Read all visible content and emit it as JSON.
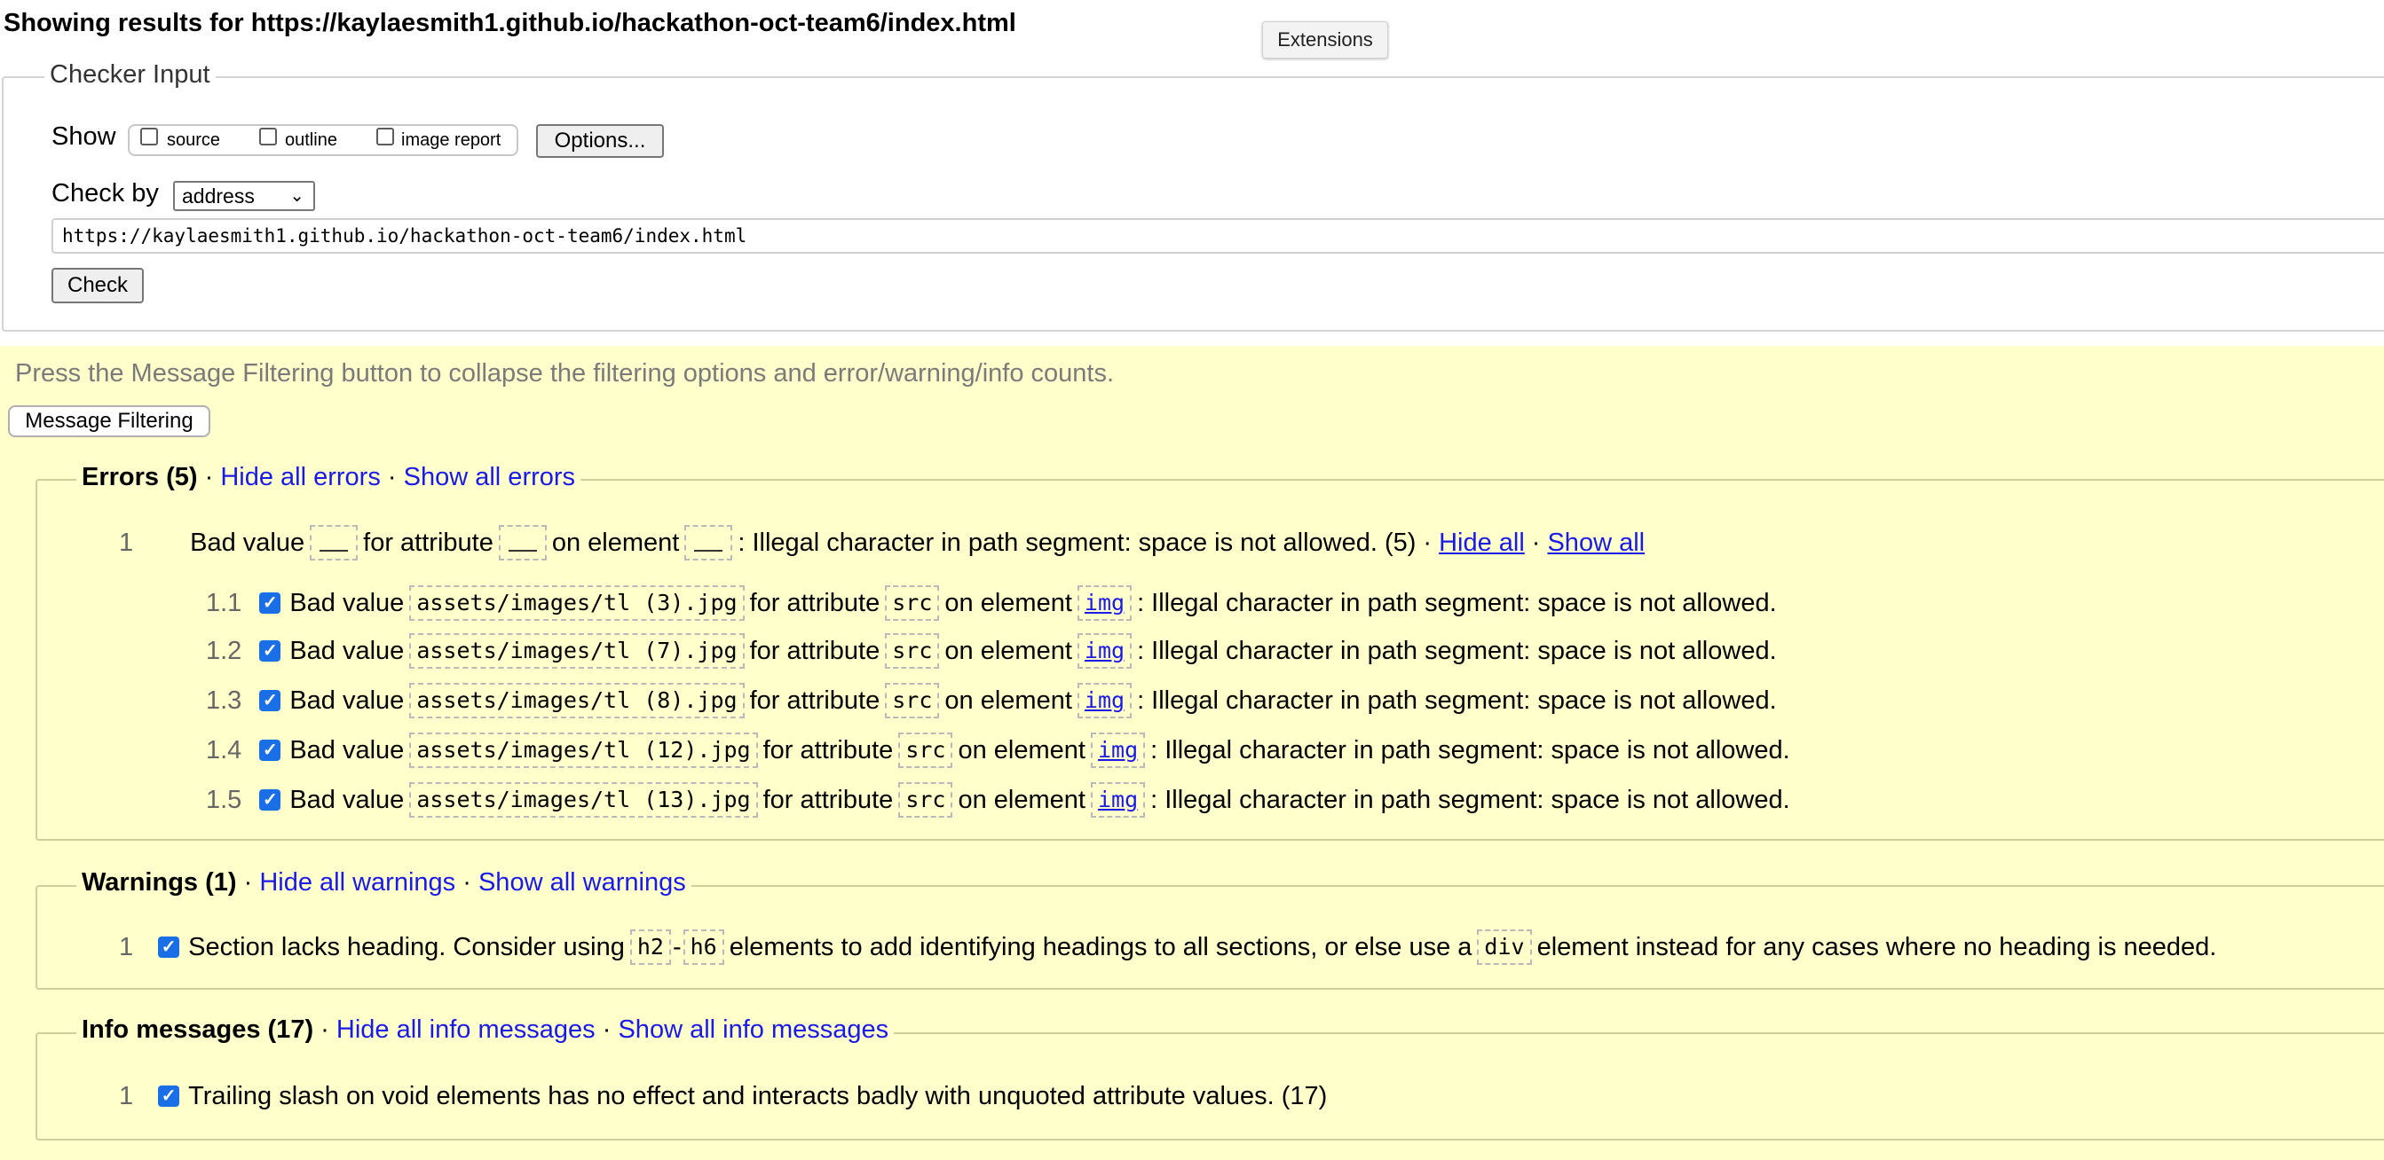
{
  "page": {
    "heading": "Showing results for https://kaylaesmith1.github.io/hackathon-oct-team6/index.html",
    "extensions_tooltip": "Extensions"
  },
  "checker": {
    "legend": "Checker Input",
    "show_label": "Show",
    "options": [
      {
        "label": "source",
        "checked": false
      },
      {
        "label": "outline",
        "checked": false
      },
      {
        "label": "image report",
        "checked": false
      }
    ],
    "options_button": "Options...",
    "check_by_label": "Check by",
    "check_by_value": "address",
    "url_value": "https://kaylaesmith1.github.io/hackathon-oct-team6/index.html",
    "check_button": "Check"
  },
  "filtering": {
    "hint": "Press the Message Filtering button to collapse the filtering options and error/warning/info counts.",
    "button": "Message Filtering"
  },
  "errors": {
    "title": "Errors (5)",
    "sep": "·",
    "hide_all": "Hide all errors",
    "show_all": "Show all errors",
    "group": {
      "number": "1",
      "t1": "Bad value",
      "t2": "for attribute",
      "t3": "on element",
      "t4": ": Illegal character in path segment: space is not allowed. (5)",
      "hide": "Hide all",
      "show": "Show all"
    },
    "items": [
      {
        "number": "1.1",
        "checked": true,
        "prefix": "Bad value",
        "value": "assets/images/tl (3).jpg",
        "mid1": "for attribute",
        "attr": "src",
        "mid2": "on element",
        "element": "img",
        "message": ": Illegal character in path segment: space is not allowed."
      },
      {
        "number": "1.2",
        "checked": true,
        "prefix": "Bad value",
        "value": "assets/images/tl (7).jpg",
        "mid1": "for attribute",
        "attr": "src",
        "mid2": "on element",
        "element": "img",
        "message": ": Illegal character in path segment: space is not allowed."
      },
      {
        "number": "1.3",
        "checked": true,
        "prefix": "Bad value",
        "value": "assets/images/tl (8).jpg",
        "mid1": "for attribute",
        "attr": "src",
        "mid2": "on element",
        "element": "img",
        "message": ": Illegal character in path segment: space is not allowed."
      },
      {
        "number": "1.4",
        "checked": true,
        "prefix": "Bad value",
        "value": "assets/images/tl (12).jpg",
        "mid1": "for attribute",
        "attr": "src",
        "mid2": "on element",
        "element": "img",
        "message": ": Illegal character in path segment: space is not allowed."
      },
      {
        "number": "1.5",
        "checked": true,
        "prefix": "Bad value",
        "value": "assets/images/tl (13).jpg",
        "mid1": "for attribute",
        "attr": "src",
        "mid2": "on element",
        "element": "img",
        "message": ": Illegal character in path segment: space is not allowed."
      }
    ]
  },
  "warnings": {
    "title": "Warnings (1)",
    "sep": "·",
    "hide_all": "Hide all warnings",
    "show_all": "Show all warnings",
    "item": {
      "number": "1",
      "checked": true,
      "t1": "Section lacks heading. Consider using",
      "code1": "h2",
      "dash": "-",
      "code2": "h6",
      "t2": "elements to add identifying headings to all sections, or else use a",
      "code3": "div",
      "t3": "element instead for any cases where no heading is needed."
    }
  },
  "info": {
    "title": "Info messages (17)",
    "sep": "·",
    "hide_all": "Hide all info messages",
    "show_all": "Show all info messages",
    "item": {
      "number": "1",
      "checked": true,
      "text": "Trailing slash on void elements has no effect and interacts badly with unquoted attribute values. (17)"
    }
  },
  "colors": {
    "link": "#1a1ae6",
    "filter_background": "#ffffcc",
    "checkbox_checked": "#1a6fe6"
  }
}
